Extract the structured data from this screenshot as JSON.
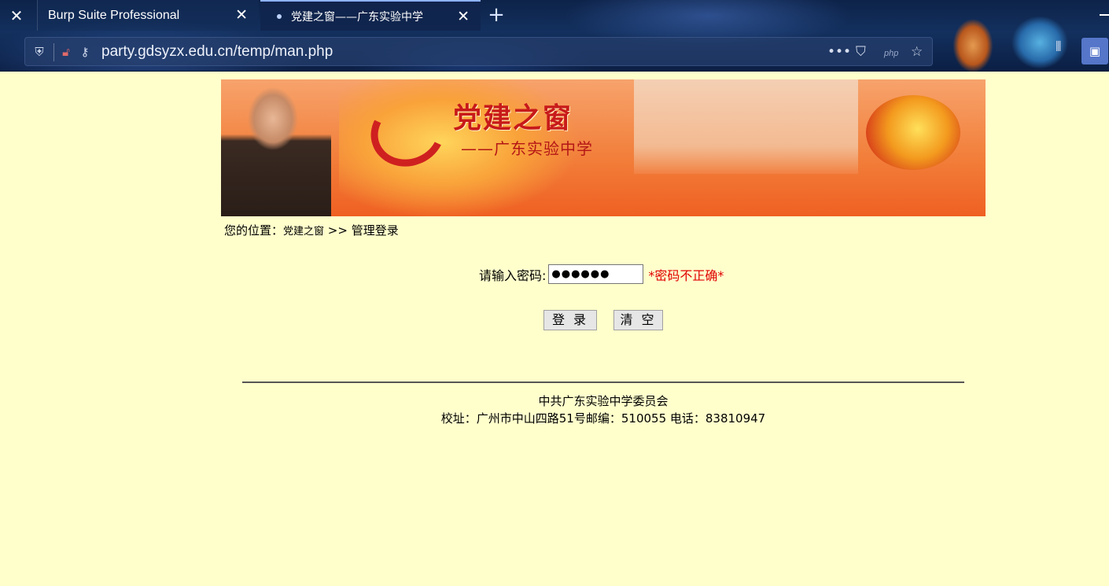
{
  "browser": {
    "tabs": [
      {
        "label": "Burp Suite Professional",
        "active": false
      },
      {
        "label": "党建之窗——广东实验中学",
        "active": true
      }
    ],
    "url": "party.gdsyzx.edu.cn/temp/man.php",
    "php_badge": "php"
  },
  "page": {
    "banner": {
      "title": "党建之窗",
      "subtitle": "——广东实验中学"
    },
    "breadcrumb": {
      "prefix": "您的位置：",
      "link": "党建之窗",
      "separator": " >> ",
      "current": "管理登录"
    },
    "login": {
      "password_label": "请输入密码:",
      "password_value": "●●●●●●",
      "error": "*密码不正确*",
      "login_button": "登 录",
      "clear_button": "清 空"
    },
    "footer": {
      "line1": "中共广东实验中学委员会",
      "line2": "校址：广州市中山四路51号邮编：510055 电话：83810947"
    }
  }
}
